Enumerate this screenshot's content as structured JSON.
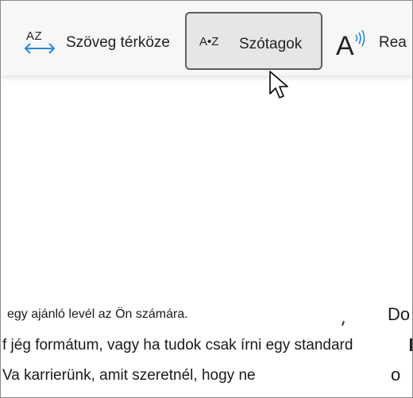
{
  "toolbar": {
    "text_spacing": {
      "icon_text": "AZ",
      "label": "Szöveg térköze"
    },
    "syllables": {
      "icon_text": "A•Z",
      "label": "Szótagok"
    },
    "read_aloud": {
      "label": "Rea"
    }
  },
  "document": {
    "line1": "egy ajánló levél az Ön számára.",
    "line2": "f jég formátum, vagy ha tudok csak írni egy standard",
    "line3": "Va karrierünk, amit szeretnél, hogy ne",
    "right_col_1": "Do",
    "right_col_2": "o"
  },
  "colors": {
    "accent_blue": "#2b88d8",
    "button_bg": "#e6e6e6",
    "button_border": "#5e5e5e",
    "toolbar_bg": "#f7f7f7"
  }
}
